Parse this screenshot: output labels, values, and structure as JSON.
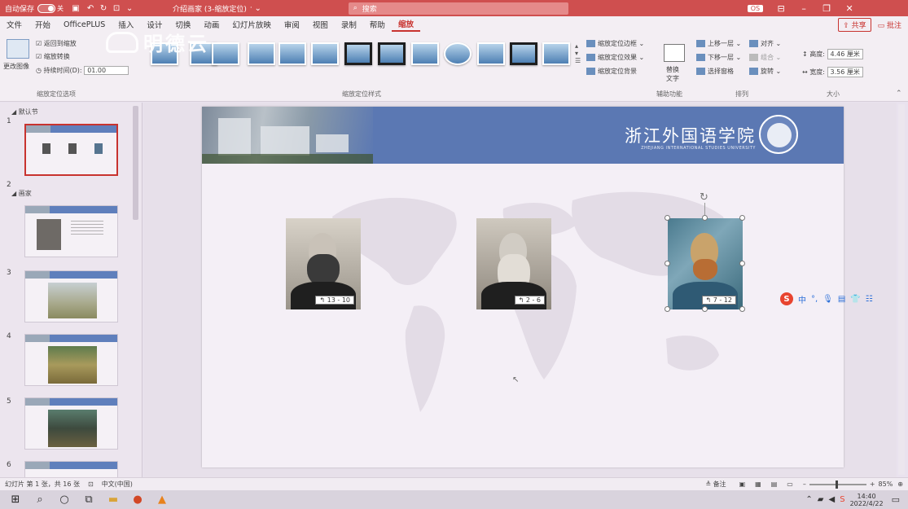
{
  "titlebar": {
    "autosave_label": "自动保存",
    "autosave_state": "关",
    "doc_title": "介绍画家 (3-缩放定位)",
    "doc_suffix": "· ",
    "search_placeholder": "搜索",
    "account_badge": "OS"
  },
  "menu": {
    "tabs": [
      "文件",
      "开始",
      "OfficePLUS",
      "插入",
      "设计",
      "切换",
      "动画",
      "幻灯片放映",
      "审阅",
      "视图",
      "录制",
      "帮助",
      "缩放"
    ],
    "active_tab": "缩放",
    "share_label": "共享",
    "comment_label": "批注"
  },
  "watermark": {
    "text": "明德云"
  },
  "ribbon": {
    "zoom_options": {
      "return_to_zoom": "返回到缩放",
      "zoom_transition": "缩放转换",
      "duration_label": "持续时间(D):",
      "duration_value": "01.00",
      "change_image": "更改图像",
      "group_label": "缩放定位选项"
    },
    "styles_group_label": "缩放定位样式",
    "style_extras": {
      "border": "缩放定位边框",
      "effects": "缩放定位效果",
      "background": "缩放定位背景"
    },
    "alt_text": {
      "label_line1": "替换",
      "label_line2": "文字",
      "group_label": "辅助功能"
    },
    "arrange": {
      "bring_forward": "上移一层",
      "align": "对齐",
      "send_backward": "下移一层",
      "group": "组合",
      "selection_pane": "选择窗格",
      "rotate": "旋转",
      "group_label": "排列"
    },
    "size": {
      "height_label": "高度:",
      "height_value": "4.46 厘米",
      "width_label": "宽度:",
      "width_value": "3.56 厘米",
      "group_label": "大小"
    }
  },
  "thumbnails": {
    "sections": [
      {
        "label": "默认节"
      },
      {
        "label": "画家"
      }
    ],
    "slide_numbers": [
      "1",
      "2",
      "3",
      "4",
      "5",
      "6"
    ]
  },
  "slide": {
    "university_cn": "浙江外国语学院",
    "university_en": "ZHEJIANG INTERNATIONAL STUDIES UNIVERSITY",
    "zoom_links": [
      {
        "label": "↰ 13 - 10"
      },
      {
        "label": "↰ 2 - 6"
      },
      {
        "label": "↰ 7 - 12"
      }
    ]
  },
  "ime": {
    "brand": "S",
    "mode": "中"
  },
  "statusbar": {
    "slide_info": "幻灯片 第 1 张，共 16 张",
    "language": "中文(中国)",
    "notes_label": "备注",
    "zoom_value": "85%"
  },
  "taskbar": {
    "time": "14:40",
    "date": "2022/4/22"
  },
  "colors": {
    "titlebar": "#cf4f4f",
    "accent": "#c8332f",
    "slide_header": "#5b78b3"
  }
}
